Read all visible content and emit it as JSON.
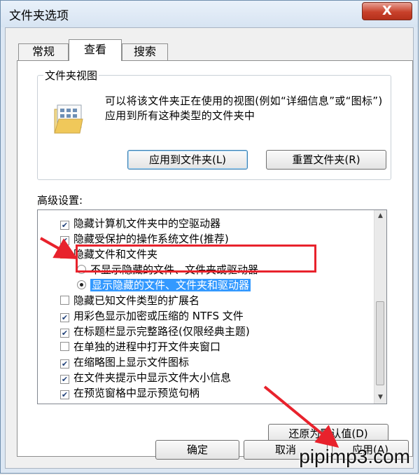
{
  "window": {
    "title": "文件夹选项",
    "close_label": "X"
  },
  "tabs": [
    {
      "label": "常规",
      "active": false
    },
    {
      "label": "查看",
      "active": true
    },
    {
      "label": "搜索",
      "active": false
    }
  ],
  "folder_views": {
    "title": "文件夹视图",
    "description": "可以将该文件夹正在使用的视图(例如“详细信息”或“图标”)应用到所有这种类型的文件夹中",
    "apply_button": "应用到文件夹(L)",
    "reset_button": "重置文件夹(R)"
  },
  "advanced": {
    "label": "高级设置:",
    "items": [
      {
        "type": "checkbox",
        "checked": true,
        "label": "隐藏计算机文件夹中的空驱动器"
      },
      {
        "type": "checkbox",
        "checked": true,
        "label": "隐藏受保护的操作系统文件(推荐)"
      },
      {
        "type": "folder",
        "label": "隐藏文件和文件夹"
      },
      {
        "type": "radio",
        "checked": false,
        "label": "不显示隐藏的文件、文件夹或驱动器"
      },
      {
        "type": "radio",
        "checked": true,
        "label": "显示隐藏的文件、文件夹和驱动器",
        "selected": true
      },
      {
        "type": "checkbox",
        "checked": false,
        "label": "隐藏已知文件类型的扩展名"
      },
      {
        "type": "checkbox",
        "checked": true,
        "label": "用彩色显示加密或压缩的 NTFS 文件"
      },
      {
        "type": "checkbox",
        "checked": true,
        "label": "在标题栏显示完整路径(仅限经典主题)"
      },
      {
        "type": "checkbox",
        "checked": false,
        "label": "在单独的进程中打开文件夹窗口"
      },
      {
        "type": "checkbox",
        "checked": true,
        "label": "在缩略图上显示文件图标"
      },
      {
        "type": "checkbox",
        "checked": true,
        "label": "在文件夹提示中显示文件大小信息"
      },
      {
        "type": "checkbox",
        "checked": true,
        "label": "在预览窗格中显示预览句柄"
      }
    ],
    "restore_button": "还原为默认值(D)"
  },
  "footer": {
    "ok_button": "确定",
    "cancel_button": "取消",
    "apply_button": "应用(A)"
  },
  "watermark": "pipimp3.com",
  "colors": {
    "selection": "#3399ff",
    "annotation_red": "#e8222c"
  }
}
